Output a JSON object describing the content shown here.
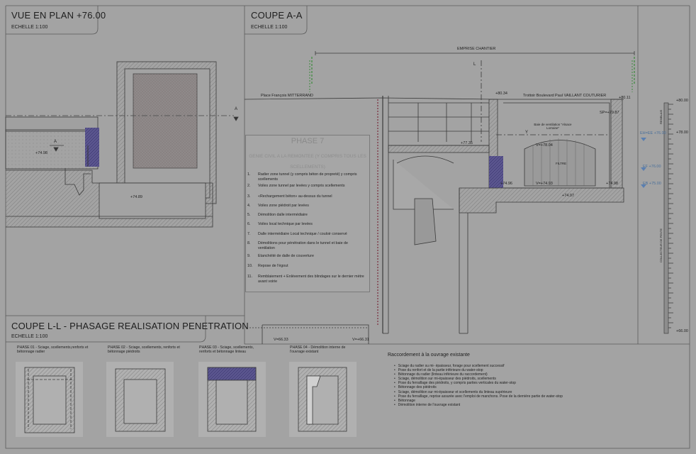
{
  "panels": {
    "plan": {
      "title": "VUE EN PLAN +76.00",
      "scale": "ECHELLE  1:100"
    },
    "section_aa": {
      "title": "COUPE A-A",
      "scale": "ECHELLE  1:100"
    },
    "section_ll": {
      "title": "COUPE L-L - PHASAGE REALISATION PENETRATION",
      "scale": "ECHELLE  1:100"
    }
  },
  "plan_labels": {
    "cut_a_top": "A",
    "cut_a_left": "A",
    "level_1": "+74.98",
    "level_2": "+74.89"
  },
  "section_labels": {
    "emprise": "EMPRISE CHANTIER",
    "cut_l": "L",
    "place": "Place François MITTERRAND",
    "trottoir": "Trottoir Boulevard Paul VAILLANT COUTURIER",
    "baie": "Baie de ventilation \"Alsace Lorraine\"",
    "filtre": "FILTRE",
    "cut_y": "Y",
    "lv_8034": "+80.34",
    "lv_8011": "+80.11",
    "lv_7987": "SP=+79.87",
    "lv_7804": "V=+78.04",
    "lv_7735": "+77.35",
    "lv_7496a": "+74.96",
    "lv_7497": "+74.97",
    "lv_7498": "+74.98",
    "lv_7493": "V=+74.93",
    "lv_6633": "V=66.33",
    "lv_6631": "V=+66.31",
    "ruler_8000": "+80.00",
    "ruler_7800": "+78.00",
    "ruler_6600": "+66.00",
    "ruler_top": "REMBLAIS",
    "ruler_mid": "COLLECTEUR DE PENTE",
    "lv_eh": "EH=EE +76.00",
    "lv_ef": "EF +76.00",
    "lv_eb": "EB +75.00"
  },
  "phase7": {
    "title": "PHASE 7",
    "subtitle": "GENIE CIVIL A LA REMONTEE (Y COMPRIS TOUS LES SCELLEMENTS)",
    "steps": [
      {
        "n": "1.",
        "text": "Radier zone tunnel (y compris béton de propreté) y compris scellements"
      },
      {
        "n": "2.",
        "text": "Voiles zone tunnel par levées y compris scellements"
      },
      {
        "n": "3.",
        "text": "«Rechargement béton» au-dessus du tunnel"
      },
      {
        "n": "4.",
        "text": "Voiles zone piédroit par levées"
      },
      {
        "n": "5.",
        "text": "Démolition dalle intermédiaire"
      },
      {
        "n": "6.",
        "text": "Voiles local technique par levées"
      },
      {
        "n": "7.",
        "text": "Dalle intermédiaire Local technique / couloir conservé"
      },
      {
        "n": "8.",
        "text": "Démolitions pour pénétration dans le tunnel et baie de ventilation"
      },
      {
        "n": "9.",
        "text": "Etanchéité de dalle de couverture"
      },
      {
        "n": "10.",
        "text": "Repose de l'égout"
      },
      {
        "n": "11.",
        "text": "Remblaiement + Enlèvement des blindages sur le dernier mètre avant voirie"
      }
    ]
  },
  "phasing": [
    {
      "label": "PHASE 01 - Sciage, scellements,renforts et bétonnage radier"
    },
    {
      "label": "PHASE 02 - Sciage, scellements, renforts et bétonnage piédroits"
    },
    {
      "label": "PHASE 03 - Sciage, scellements, renforts et bétonnage linteau"
    },
    {
      "label": "PHASE 04 - Démolition interne de l'ouvrage existant"
    }
  ],
  "raccordement": {
    "title": "Raccordement à la ouvrage existante",
    "items": [
      "Sciage du radier su mi- épaisseur, forage pour scellement successif",
      "Pose du renfort et de la partie inférieure du water-stop",
      "Bétonnage du radier (linteau inférieure du raccordement)",
      "Sciage, démolition sur mi-épaisseur des piédroits, scellements",
      "Pose du ferraillage des piédroits, y compris parties verticales du water-stop",
      "Bétonnage des piédroits",
      "Sciage, démolition sur mi-épaisseur et scellements du linteau supérieure",
      "Pose du ferraillage, reprise assurée avec l'emploi de manchons. Pose de la dernière partie de water-stop",
      "Bétonnage",
      "Démolition interne de l'ouvrage existant"
    ]
  },
  "colors": {
    "background": "#a3a3a3",
    "line": "#3a3a3a",
    "hatch": "#6f6f6f",
    "steel": "#4a3f7a",
    "rebar": "#7a2a3a",
    "green_stake": "#3c8a3c",
    "blue_marker": "#5a7fb0"
  }
}
